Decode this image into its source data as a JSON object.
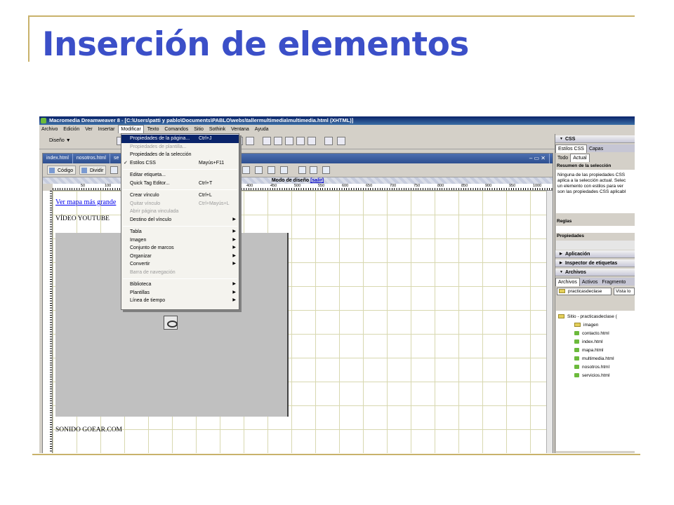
{
  "slide": {
    "title": "Inserción de elementos"
  },
  "window": {
    "title": "Macromedia Dreamweaver 8 - [C:\\Users\\patti y pablo\\Documents\\PABLO\\webs\\tallermultimedia\\multimedia.html (XHTML)]"
  },
  "menubar": [
    "Archivo",
    "Edición",
    "Ver",
    "Insertar",
    "Modificar",
    "Texto",
    "Comandos",
    "Sitio",
    "Sothink",
    "Ventana",
    "Ayuda"
  ],
  "toolbar": {
    "mode_label": "Diseño"
  },
  "doc_tabs": [
    "index.html",
    "nosotros.html",
    "se"
  ],
  "doc_toolbar": {
    "code": "Código",
    "split": "Dividir"
  },
  "mode_bar": {
    "label": "Modo de diseño",
    "exit": "[salir]"
  },
  "ruler_ticks": [
    "50",
    "100",
    "400",
    "450",
    "500",
    "550",
    "600",
    "650",
    "700",
    "750",
    "800",
    "850",
    "900",
    "950",
    "1000"
  ],
  "page": {
    "map_link": "Ver mapa más grande",
    "video_label": "VÍDEO YOUTUBE",
    "sound_label": "SONIDO GOEAR.COM"
  },
  "dropdown": {
    "items": [
      {
        "label": "Propiedades de la página...",
        "shortcut": "Ctrl+J"
      },
      {
        "label": "Propiedades de plantilla..."
      },
      {
        "label": "Propiedades de la selección"
      },
      {
        "label": "Estilos CSS",
        "shortcut": "Mayús+F11"
      },
      {
        "label": "Editar etiqueta..."
      },
      {
        "label": "Quick Tag Editor...",
        "shortcut": "Ctrl+T"
      },
      {
        "label": "Crear vínculo",
        "shortcut": "Ctrl+L"
      },
      {
        "label": "Quitar vínculo",
        "shortcut": "Ctrl+Mayús+L"
      },
      {
        "label": "Abrir página vinculada"
      },
      {
        "label": "Destino del vínculo"
      },
      {
        "label": "Tabla"
      },
      {
        "label": "Imagen"
      },
      {
        "label": "Conjunto de marcos"
      },
      {
        "label": "Organizar"
      },
      {
        "label": "Convertir"
      },
      {
        "label": "Barra de navegación"
      },
      {
        "label": "Biblioteca"
      },
      {
        "label": "Plantillas"
      },
      {
        "label": "Línea de tiempo"
      }
    ]
  },
  "panels": {
    "css_header": "CSS",
    "css_tabs": [
      "Estilos CSS",
      "Capas"
    ],
    "mode_tabs": [
      "Todo",
      "Actual"
    ],
    "summary_title": "Resumen de la selección",
    "summary_lines": [
      "Ninguna de las propiedades CSS",
      "aplica a la selección actual. Selec",
      "un elemento con estilos para ver",
      "son las propiedades CSS aplicabl"
    ],
    "rules_label": "Reglas",
    "props_label": "Propiedades",
    "app_header": "Aplicación",
    "tag_header": "Inspector de etiquetas",
    "files_header": "Archivos",
    "files_tabs": [
      "Archivos",
      "Activos",
      "Fragmento"
    ],
    "site_select": "practicasdeclase",
    "view_select": "Vista lo",
    "site_root": "Sitio - practicasdeclase (",
    "files": [
      "imagen",
      "contacto.html",
      "index.html",
      "mapa.html",
      "multimedia.html",
      "nosotros.html",
      "servicios.html"
    ]
  }
}
